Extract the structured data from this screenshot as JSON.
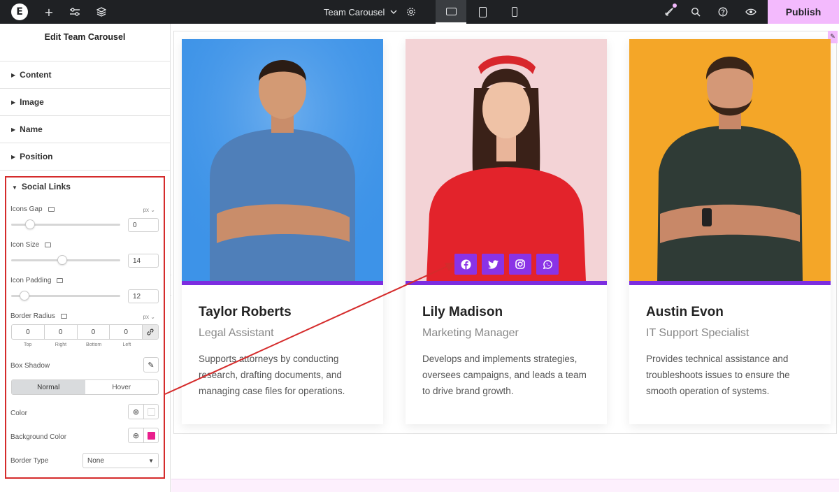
{
  "topbar": {
    "page_title": "Team Carousel",
    "publish_label": "Publish"
  },
  "sidebar": {
    "header": "Edit Team Carousel",
    "sections": [
      {
        "label": "Content"
      },
      {
        "label": "Image"
      },
      {
        "label": "Name"
      },
      {
        "label": "Position"
      }
    ],
    "social_links": {
      "title": "Social Links",
      "icons_gap": {
        "label": "Icons Gap",
        "unit": "px",
        "value": "0",
        "slider_fraction": 0.17
      },
      "icon_size": {
        "label": "Icon Size",
        "value": "14",
        "slider_fraction": 0.47
      },
      "icon_padding": {
        "label": "Icon Padding",
        "value": "12",
        "slider_fraction": 0.12
      },
      "border_radius": {
        "label": "Border Radius",
        "unit": "px",
        "values": [
          "0",
          "0",
          "0",
          "0"
        ],
        "sides": [
          "Top",
          "Right",
          "Bottom",
          "Left"
        ]
      },
      "box_shadow": {
        "label": "Box Shadow"
      },
      "state_tabs": [
        "Normal",
        "Hover"
      ],
      "color": {
        "label": "Color",
        "swatch": "#ffffff"
      },
      "background_color": {
        "label": "Background Color",
        "swatch": "#e91e8c"
      },
      "border_type": {
        "label": "Border Type",
        "value": "None"
      }
    }
  },
  "colors": {
    "accent_bar": "#7c2de0",
    "social_bg": "#8a33e6",
    "publish_bg": "#f3bafd",
    "annotation": "#d52b2b"
  },
  "team": [
    {
      "name": "Taylor Roberts",
      "role": "Legal Assistant",
      "description": "Supports attorneys by conducting research, drafting documents, and managing case files for operations.",
      "photo_bg": "#3d93e8",
      "shirt": "#4f7fb9"
    },
    {
      "name": "Lily Madison",
      "role": "Marketing Manager",
      "description": "Develops and implements strategies, oversees campaigns, and leads a team to drive brand growth.",
      "photo_bg": "#f3d3d6",
      "shirt": "#e3232b",
      "social_icons": [
        "facebook-icon",
        "twitter-icon",
        "instagram-icon",
        "whatsapp-icon"
      ]
    },
    {
      "name": "Austin Evon",
      "role": "IT Support Specialist",
      "description": "Provides technical assistance and troubleshoots issues to ensure the smooth operation of systems.",
      "photo_bg": "#f4a628",
      "shirt": "#2f3b36"
    }
  ]
}
